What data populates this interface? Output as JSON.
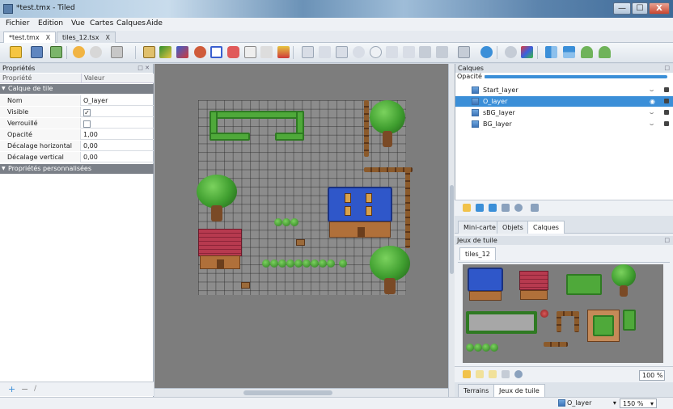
{
  "window": {
    "title": "*test.tmx - Tiled",
    "min": "—",
    "max": "☐",
    "close": "X"
  },
  "menu": [
    {
      "label": "Fichier"
    },
    {
      "label": "Edition"
    },
    {
      "label": "Vue"
    },
    {
      "label": "Cartes"
    },
    {
      "label": "Calques"
    },
    {
      "label": "Aide"
    }
  ],
  "tabs": [
    {
      "label": "*test.tmx",
      "close": "X"
    },
    {
      "label": "tiles_12.tsx",
      "close": "X"
    }
  ],
  "properties": {
    "title": "Propriétés",
    "col_property": "Propriété",
    "col_value": "Valeur",
    "group1": "Calque de tile",
    "rows": [
      {
        "key": "Nom",
        "value": "O_layer"
      },
      {
        "key": "Visible",
        "value": "✓"
      },
      {
        "key": "Verrouillé",
        "value": ""
      },
      {
        "key": "Opacité",
        "value": "1,00"
      },
      {
        "key": "Décalage horizontal",
        "value": "0,00"
      },
      {
        "key": "Décalage vertical",
        "value": "0,00"
      }
    ],
    "group2": "Propriétés personnalisées",
    "footer": {
      "add": "+",
      "remove": "−",
      "edit": "/"
    }
  },
  "layers": {
    "title": "Calques",
    "opacity_label": "Opacité :",
    "items": [
      {
        "name": "Start_layer",
        "selected": false
      },
      {
        "name": "O_layer",
        "selected": true
      },
      {
        "name": "sBG_layer",
        "selected": false
      },
      {
        "name": "BG_layer",
        "selected": false
      }
    ]
  },
  "panel_tabs": [
    {
      "label": "Mini-carte"
    },
    {
      "label": "Objets"
    },
    {
      "label": "Calques"
    }
  ],
  "tilesets": {
    "title": "Jeux de tuile",
    "tab": "tiles_12",
    "zoom": "100 %"
  },
  "bottom_tabs": [
    {
      "label": "Terrains"
    },
    {
      "label": "Jeux de tuile"
    }
  ],
  "status": {
    "layer": "O_layer",
    "zoom": "150 %",
    "dropdown": "▾"
  },
  "colors": {
    "accent": "#3b8fd8",
    "grass": "#4fa93a",
    "roof_blue": "#2f57c9",
    "roof_red": "#b73a4f",
    "wood": "#8b5a2b"
  }
}
